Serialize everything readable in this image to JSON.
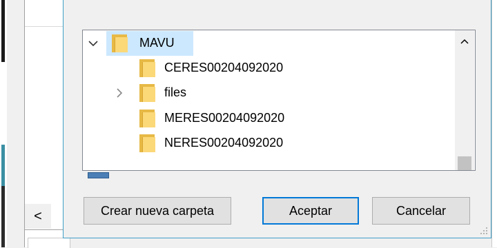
{
  "dialog": {
    "tree": {
      "root": {
        "label": "MAVU",
        "expanded": true,
        "selected": true
      },
      "children": [
        {
          "label": "CERES00204092020",
          "expandable": false
        },
        {
          "label": "files",
          "expandable": true
        },
        {
          "label": "MERES00204092020",
          "expandable": false
        },
        {
          "label": "NERES00204092020",
          "expandable": false
        }
      ]
    },
    "buttons": {
      "new_folder": "Crear nueva carpeta",
      "ok": "Aceptar",
      "cancel": "Cancelar"
    }
  },
  "icons": {
    "expand_down": "⌄",
    "expand_right": "›",
    "scroll_up": "^",
    "scroll_left": "<"
  },
  "colors": {
    "accent": "#0078d7",
    "selection": "#cce8ff",
    "folder": "#fbd878"
  }
}
